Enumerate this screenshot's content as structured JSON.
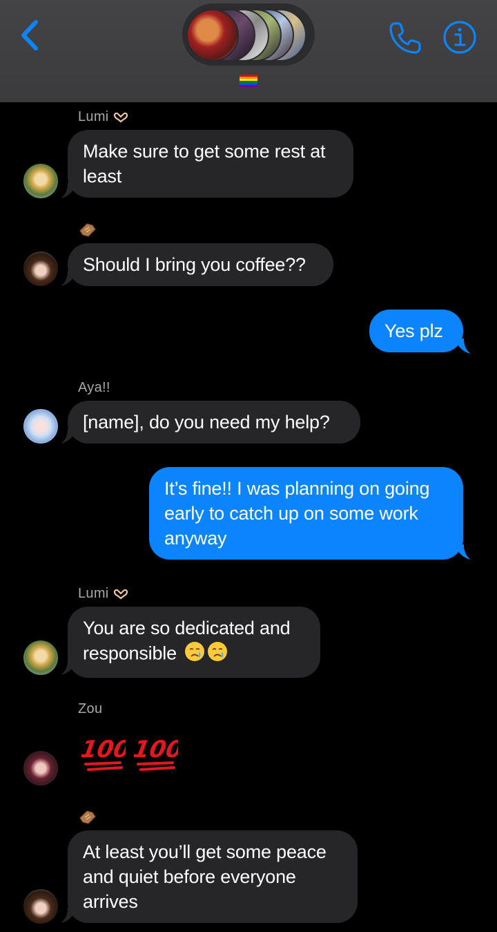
{
  "header": {
    "back_icon": "chevron-left-icon",
    "call_icon": "phone-icon",
    "info_icon": "info-icon",
    "group_icon": "pride-flag-icon"
  },
  "colors": {
    "accent": "#0b84fe",
    "header_bg": "#3d3d3f",
    "incoming_bubble": "#262629",
    "sender_name": "#a8a8ad"
  },
  "messages": [
    {
      "sender": "Lumi",
      "sender_icon": "heart-hands-icon",
      "text": "Make sure to get some rest at least",
      "direction": "in"
    },
    {
      "sender_icon": "coffin-icon",
      "text": "Should I bring you coffee??",
      "direction": "in"
    },
    {
      "text": "Yes plz",
      "direction": "out"
    },
    {
      "sender": "Aya!!",
      "text": "[name], do you need my help?",
      "direction": "in"
    },
    {
      "text": "It’s fine!! I was planning on going early to catch up on some work anyway",
      "direction": "out"
    },
    {
      "sender": "Lumi",
      "sender_icon": "heart-hands-icon",
      "text": "You are so dedicated and responsible",
      "emoji": "crying-face-icon",
      "direction": "in"
    },
    {
      "sender": "Zou",
      "emoji": "hundred-points-icon",
      "direction": "in"
    },
    {
      "sender_icon": "coffin-icon",
      "text": "At least you’ll get some peace and quiet before everyone arrives",
      "direction": "in"
    }
  ]
}
